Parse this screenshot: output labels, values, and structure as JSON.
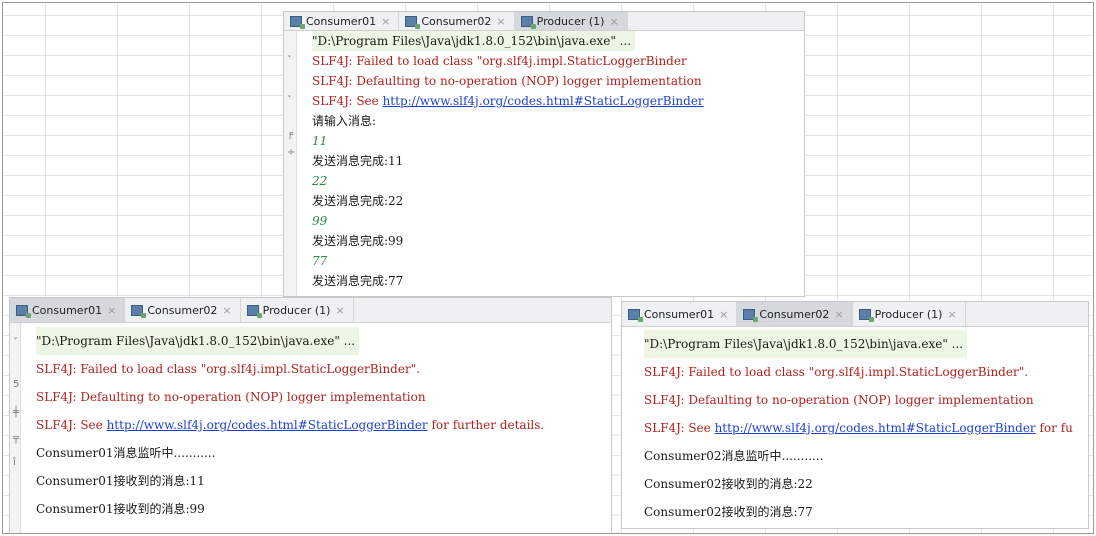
{
  "producer": {
    "tabs": [
      {
        "label": "Consumer01",
        "close": "×"
      },
      {
        "label": "Consumer02",
        "close": "×"
      },
      {
        "label": "Producer (1)",
        "close": "×"
      }
    ],
    "active_tab": "Producer (1)",
    "command": "\"D:\\Program Files\\Java\\jdk1.8.0_152\\bin\\java.exe\" ...",
    "err1": "SLF4J: Failed to load class \"org.slf4j.impl.StaticLoggerBinder",
    "err2": "SLF4J: Defaulting to no-operation (NOP) logger implementation",
    "err3_prefix": "SLF4J: See ",
    "err3_link": "http://www.slf4j.org/codes.html#StaticLoggerBinder",
    "prompt": "请输入消息:",
    "entries": [
      {
        "input": "11",
        "result": "发送消息完成:11"
      },
      {
        "input": "22",
        "result": "发送消息完成:22"
      },
      {
        "input": "99",
        "result": "发送消息完成:99"
      },
      {
        "input": "77",
        "result": "发送消息完成:77"
      }
    ]
  },
  "consumer01": {
    "tabs": [
      {
        "label": "Consumer01",
        "close": "×"
      },
      {
        "label": "Consumer02",
        "close": "×"
      },
      {
        "label": "Producer (1)",
        "close": "×"
      }
    ],
    "active_tab": "Consumer01",
    "command": "\"D:\\Program Files\\Java\\jdk1.8.0_152\\bin\\java.exe\" ...",
    "err1": "SLF4J: Failed to load class \"org.slf4j.impl.StaticLoggerBinder\".",
    "err2": "SLF4J: Defaulting to no-operation (NOP) logger implementation",
    "err3_prefix": "SLF4J: See ",
    "err3_link": "http://www.slf4j.org/codes.html#StaticLoggerBinder",
    "err3_suffix": " for further details.",
    "listening": "Consumer01消息监听中...........",
    "received": [
      "Consumer01接收到的消息:11",
      "Consumer01接收到的消息:99"
    ]
  },
  "consumer02": {
    "tabs": [
      {
        "label": "Consumer01",
        "close": "×"
      },
      {
        "label": "Consumer02",
        "close": "×"
      },
      {
        "label": "Producer (1)",
        "close": "×"
      }
    ],
    "active_tab": "Consumer02",
    "command": "\"D:\\Program Files\\Java\\jdk1.8.0_152\\bin\\java.exe\" ...",
    "err1": "SLF4J: Failed to load class \"org.slf4j.impl.StaticLoggerBinder\".",
    "err2": "SLF4J: Defaulting to no-operation (NOP) logger implementation",
    "err3_prefix": "SLF4J: See ",
    "err3_link": "http://www.slf4j.org/codes.html#StaticLoggerBinder",
    "err3_suffix": " for fu",
    "listening": "Consumer02消息监听中...........",
    "received": [
      "Consumer02接收到的消息:22",
      "Consumer02接收到的消息:77"
    ]
  },
  "icons": {
    "tab_icon": "console-tab-icon",
    "gutter": [
      "rerun-icon",
      "stop-icon",
      "pin-icon",
      "scroll-icon"
    ]
  },
  "colors": {
    "error_text": "#b0211e",
    "link": "#1d3fcf",
    "user_input": "#2d8a3f",
    "command_bg": "#edf6e4",
    "active_tab_bg": "#d5d9de"
  }
}
